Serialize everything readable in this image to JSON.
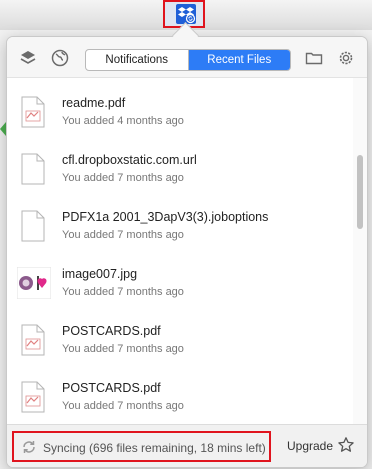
{
  "tabs": [
    {
      "label": "Notifications",
      "active": false
    },
    {
      "label": "Recent Files",
      "active": true
    }
  ],
  "files": [
    {
      "name": "readme.pdf",
      "meta": "You added 4 months ago",
      "icon": "pdf-file-icon"
    },
    {
      "name": "cfl.dropboxstatic.com.url",
      "meta": "You added 7 months ago",
      "icon": "generic-file-icon"
    },
    {
      "name": "PDFX1a 2001_3DapV3(3).joboptions",
      "meta": "You added 7 months ago",
      "icon": "generic-file-icon"
    },
    {
      "name": "image007.jpg",
      "meta": "You added 7 months ago",
      "icon": "image-thumbnail"
    },
    {
      "name": "POSTCARDS.pdf",
      "meta": "You added 7 months ago",
      "icon": "pdf-file-icon"
    },
    {
      "name": "POSTCARDS.pdf",
      "meta": "You added 7 months ago",
      "icon": "pdf-file-icon"
    }
  ],
  "footer": {
    "status": "Syncing (696 files remaining, 18 mins left)",
    "upgrade_label": "Upgrade"
  },
  "colors": {
    "accent": "#2d7cf6",
    "highlight": "#e0141e",
    "dropbox": "#1f5fd7"
  }
}
